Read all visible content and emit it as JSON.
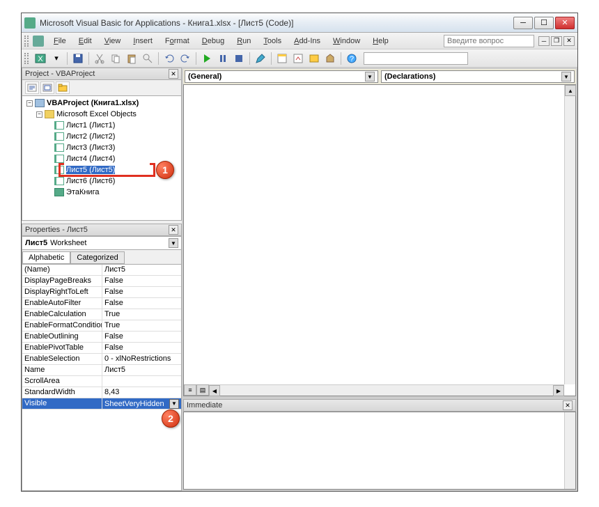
{
  "title": "Microsoft Visual Basic for Applications - Книга1.xlsx - [Лист5 (Code)]",
  "menu": {
    "file": "File",
    "edit": "Edit",
    "view": "View",
    "insert": "Insert",
    "format": "Format",
    "debug": "Debug",
    "run": "Run",
    "tools": "Tools",
    "addins": "Add-Ins",
    "window": "Window",
    "help": "Help",
    "ask": "Введите вопрос"
  },
  "project": {
    "title": "Project - VBAProject",
    "root": "VBAProject (Книга1.xlsx)",
    "folder": "Microsoft Excel Objects",
    "sheets": [
      "Лист1 (Лист1)",
      "Лист2 (Лист2)",
      "Лист3 (Лист3)",
      "Лист4 (Лист4)",
      "Лист5 (Лист5)",
      "Лист6 (Лист6)"
    ],
    "thisbook": "ЭтаКнига"
  },
  "properties": {
    "title": "Properties - Лист5",
    "object_name": "Лист5",
    "object_type": "Worksheet",
    "tabs": {
      "alpha": "Alphabetic",
      "cat": "Categorized"
    },
    "rows": [
      {
        "n": "(Name)",
        "v": "Лист5"
      },
      {
        "n": "DisplayPageBreaks",
        "v": "False"
      },
      {
        "n": "DisplayRightToLeft",
        "v": "False"
      },
      {
        "n": "EnableAutoFilter",
        "v": "False"
      },
      {
        "n": "EnableCalculation",
        "v": "True"
      },
      {
        "n": "EnableFormatConditionsCalculation",
        "v": "True"
      },
      {
        "n": "EnableOutlining",
        "v": "False"
      },
      {
        "n": "EnablePivotTable",
        "v": "False"
      },
      {
        "n": "EnableSelection",
        "v": "0 - xlNoRestrictions"
      },
      {
        "n": "Name",
        "v": "Лист5"
      },
      {
        "n": "ScrollArea",
        "v": ""
      },
      {
        "n": "StandardWidth",
        "v": "8,43"
      },
      {
        "n": "Visible",
        "v": "SheetVeryHidden"
      }
    ]
  },
  "code": {
    "left_combo": "(General)",
    "right_combo": "(Declarations)"
  },
  "immediate": {
    "title": "Immediate"
  },
  "badges": {
    "b1": "1",
    "b2": "2"
  }
}
